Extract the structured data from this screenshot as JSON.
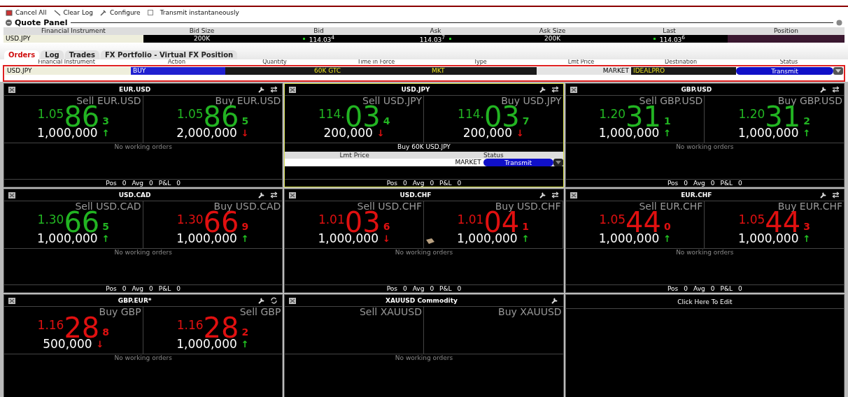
{
  "toolbar": {
    "items": [
      {
        "label": "Cancel All",
        "kind": "cancel"
      },
      {
        "label": "Clear Log",
        "kind": "clear"
      },
      {
        "label": "Configure",
        "kind": "configure"
      }
    ],
    "transmit": {
      "label": "Transmit instantaneously",
      "checked": false
    }
  },
  "quote_panel": {
    "title": "Quote Panel",
    "columns": [
      "Financial Instrument",
      "Bid Size",
      "Bid",
      "Ask",
      "Ask Size",
      "Last",
      "Position"
    ],
    "row": {
      "instrument": "USD.JPY",
      "bid_size": "200K",
      "bid": "114.03$^{4}$",
      "ask": "114.03$^{7}$",
      "ask_size": "200K",
      "last": "114.03$^{6}$"
    }
  },
  "tabs": [
    {
      "label": "Orders",
      "selected": true
    },
    {
      "label": "Log",
      "selected": false
    },
    {
      "label": "Trades",
      "selected": false
    },
    {
      "label": "FX Portfolio - Virtual FX Position",
      "selected": false
    }
  ],
  "orders": {
    "columns": [
      "Financial Instrument",
      "Action",
      "Quantity",
      "Time in Force",
      "Type",
      "Lmt Price",
      "Destination",
      "Status"
    ],
    "row": {
      "instrument": "USD.JPY",
      "action": "BUY",
      "quantity": "60K GTC",
      "type": "MKT",
      "lmt_price": "MARKET",
      "destination": "IDEALPRO",
      "status": "Transmit"
    }
  },
  "tiles": [
    {
      "kind": "quote",
      "title": "EUR.USD",
      "selected": false,
      "icons": [
        {
          "kind": "wrench"
        },
        {
          "kind": "swap"
        }
      ],
      "sides": [
        {
          "label": "Sell EUR.USD",
          "color": "#22b422",
          "pre": "1.05",
          "big": "86",
          "pip": "3",
          "size": "1,000,000",
          "tick": {
            "text": "↑",
            "rising": true
          }
        },
        {
          "label": "Buy EUR.USD",
          "color": "#22b422",
          "pre": "1.05",
          "big": "86",
          "pip": "5",
          "size": "2,000,000",
          "tick": {
            "text": "↓",
            "rising": false
          }
        }
      ],
      "orders_text": "No working orders",
      "footer": [
        "Pos",
        "0",
        "Avg",
        "0",
        "P&L",
        "0"
      ]
    },
    {
      "kind": "quote",
      "title": "USD.JPY",
      "selected": true,
      "icons": [
        {
          "kind": "wrench"
        },
        {
          "kind": "swap"
        }
      ],
      "sides": [
        {
          "label": "Sell USD.JPY",
          "color": "#22b422",
          "pre": "114.",
          "big": "03",
          "pip": "4",
          "size": "200,000",
          "tick": {
            "text": "↓",
            "rising": false
          }
        },
        {
          "label": "Buy USD.JPY",
          "color": "#22b422",
          "pre": "114.",
          "big": "03",
          "pip": "7",
          "size": "200,000",
          "tick": {
            "text": "↓",
            "rising": false
          }
        }
      ],
      "order": {
        "title": "Buy 60K USD.JPY",
        "columns": [
          "Lmt Price",
          "Status"
        ],
        "price": "MARKET",
        "status": "Transmit"
      },
      "footer": [
        "Pos",
        "0",
        "Avg",
        "0",
        "P&L",
        "0"
      ]
    },
    {
      "kind": "quote",
      "title": "GBP.USD",
      "selected": false,
      "icons": [
        {
          "kind": "wrench"
        },
        {
          "kind": "swap"
        }
      ],
      "sides": [
        {
          "label": "Sell GBP.USD",
          "color": "#22b422",
          "pre": "1.20",
          "big": "31",
          "pip": "1",
          "size": "1,000,000",
          "tick": {
            "text": "↑",
            "rising": true
          }
        },
        {
          "label": "Buy GBP.USD",
          "color": "#22b422",
          "pre": "1.20",
          "big": "31",
          "pip": "2",
          "size": "1,000,000",
          "tick": {
            "text": "↑",
            "rising": true
          }
        }
      ],
      "orders_text": "No working orders",
      "footer": [
        "Pos",
        "0",
        "Avg",
        "0",
        "P&L",
        "0"
      ]
    },
    {
      "kind": "quote",
      "title": "USD.CAD",
      "selected": false,
      "icons": [
        {
          "kind": "wrench"
        },
        {
          "kind": "swap"
        }
      ],
      "sides": [
        {
          "label": "Sell USD.CAD",
          "color": "#22b422",
          "pre": "1.30",
          "big": "66",
          "pip": "5",
          "size": "1,000,000",
          "tick": {
            "text": "↑",
            "rising": true
          }
        },
        {
          "label": "Buy USD.CAD",
          "color": "#e01010",
          "pre": "1.30",
          "big": "66",
          "pip": "9",
          "size": "1,000,000",
          "tick": {
            "text": "↑",
            "rising": true
          }
        }
      ],
      "orders_text": "No working orders",
      "footer": [
        "Pos",
        "0",
        "Avg",
        "0",
        "P&L",
        "0"
      ]
    },
    {
      "kind": "quote",
      "title": "USD.CHF",
      "selected": false,
      "book": true,
      "icons": [
        {
          "kind": "wrench"
        },
        {
          "kind": "swap"
        }
      ],
      "sides": [
        {
          "label": "Sell USD.CHF",
          "color": "#e01010",
          "pre": "1.01",
          "big": "03",
          "pip": "6",
          "size": "1,000,000",
          "tick": {
            "text": "↓",
            "rising": false
          }
        },
        {
          "label": "Buy USD.CHF",
          "color": "#e01010",
          "pre": "1.01",
          "big": "04",
          "pip": "1",
          "size": "1,000,000",
          "tick": {
            "text": "↑",
            "rising": true
          }
        }
      ],
      "orders_text": "No working orders",
      "footer": [
        "Pos",
        "0",
        "Avg",
        "0",
        "P&L",
        "0"
      ]
    },
    {
      "kind": "quote",
      "title": "EUR.CHF",
      "selected": false,
      "icons": [
        {
          "kind": "wrench"
        },
        {
          "kind": "swap"
        }
      ],
      "sides": [
        {
          "label": "Sell EUR.CHF",
          "color": "#e01010",
          "pre": "1.05",
          "big": "44",
          "pip": "0",
          "size": "1,000,000",
          "tick": {
            "text": "↑",
            "rising": true
          }
        },
        {
          "label": "Buy EUR.CHF",
          "color": "#e01010",
          "pre": "1.05",
          "big": "44",
          "pip": "3",
          "size": "1,000,000",
          "tick": {
            "text": "↑",
            "rising": true
          }
        }
      ],
      "orders_text": "No working orders",
      "footer": [
        "Pos",
        "0",
        "Avg",
        "0",
        "P&L",
        "0"
      ]
    },
    {
      "kind": "quote",
      "title": "GBP.EUR*",
      "selected": false,
      "icons": [
        {
          "kind": "wrench"
        },
        {
          "kind": "refresh"
        }
      ],
      "sides": [
        {
          "label": "Buy GBP",
          "color": "#e01010",
          "pre": "1.16",
          "big": "28",
          "pip": "8",
          "size": "500,000",
          "tick": {
            "text": "↓",
            "rising": false
          }
        },
        {
          "label": "Sell GBP",
          "color": "#e01010",
          "pre": "1.16",
          "big": "28",
          "pip": "2",
          "size": "1,000,000",
          "tick": {
            "text": "↑",
            "rising": true
          }
        }
      ],
      "orders_text": "No working orders"
    },
    {
      "kind": "quote",
      "title": "XAUUSD Commodity",
      "selected": false,
      "icons": [
        {
          "kind": "wrench"
        }
      ],
      "sides": [
        {
          "label": "Sell XAUUSD"
        },
        {
          "label": "Buy XAUUSD"
        }
      ],
      "orders_text": "No working orders"
    },
    {
      "kind": "empty",
      "title": "Click Here To Edit"
    }
  ]
}
